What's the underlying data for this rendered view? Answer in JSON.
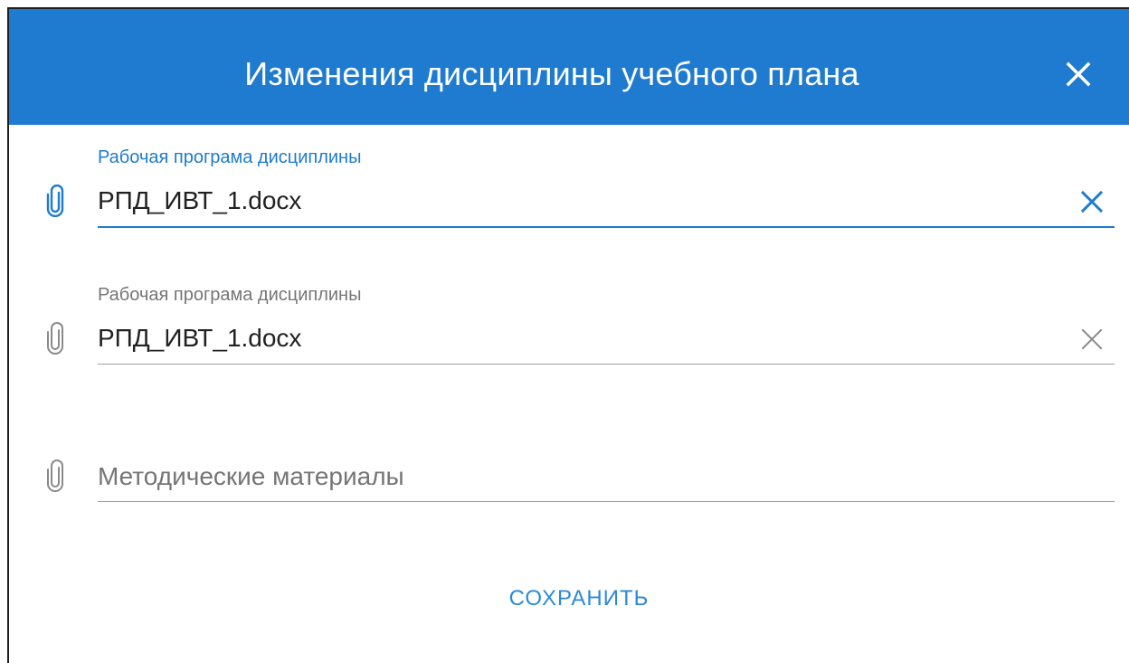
{
  "dialog": {
    "title": "Изменения дисциплины учебного плана",
    "header_color": "#1e7bd0",
    "accent_color": "#1e7bd0"
  },
  "fields": [
    {
      "label": "Рабочая програма дисциплины",
      "value": "РПД_ИВТ_1.docx",
      "state": "focused",
      "icon": "paperclip-icon",
      "clear_icon": "close-icon"
    },
    {
      "label": "Рабочая програма дисциплины",
      "value": "РПД_ИВТ_1.docx",
      "state": "filled",
      "icon": "paperclip-icon",
      "clear_icon": "close-icon"
    },
    {
      "label": "",
      "value": "",
      "placeholder": "Методические материалы",
      "state": "empty",
      "icon": "paperclip-icon"
    }
  ],
  "actions": {
    "save_label": "СОХРАНИТЬ"
  }
}
